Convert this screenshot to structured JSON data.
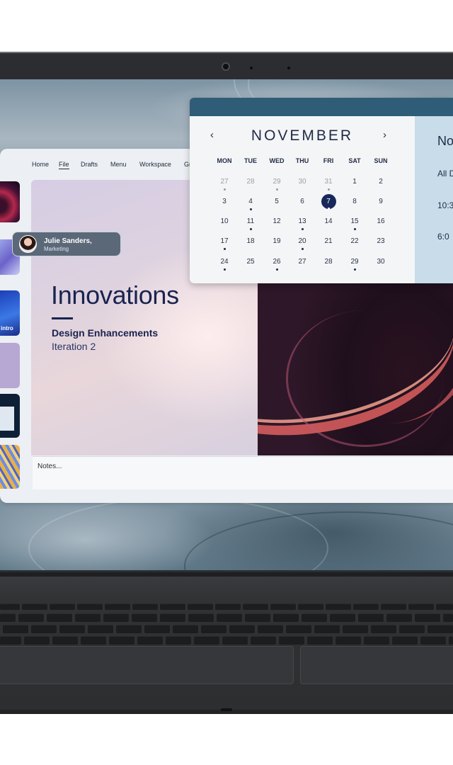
{
  "app": {
    "nav": [
      {
        "label": "Home",
        "active": false
      },
      {
        "label": "File",
        "active": true
      },
      {
        "label": "Drafts",
        "active": false
      },
      {
        "label": "Menu",
        "active": false
      },
      {
        "label": "Workspace",
        "active": false
      },
      {
        "label": "Gr",
        "active": false
      }
    ],
    "slide": {
      "title": "Innovations",
      "subtitle": "Design Enhancements",
      "iteration": "Iteration 2"
    },
    "thumbnails": [
      {
        "label": ""
      },
      {
        "label": ""
      },
      {
        "label": "intro"
      },
      {
        "label": ""
      },
      {
        "label": ""
      },
      {
        "label": ""
      }
    ],
    "notes_placeholder": "Notes..."
  },
  "user_chip": {
    "name": "Julie Sanders,",
    "role": "Marketing"
  },
  "calendar": {
    "month": "NOVEMBER",
    "prev_icon": "‹",
    "next_icon": "›",
    "weekdays": [
      "MON",
      "TUE",
      "WED",
      "THU",
      "FRI",
      "SAT",
      "SUN"
    ],
    "weeks": [
      [
        {
          "d": "27",
          "muted": true,
          "dot": true
        },
        {
          "d": "28",
          "muted": true,
          "dot": false
        },
        {
          "d": "29",
          "muted": true,
          "dot": true
        },
        {
          "d": "30",
          "muted": true,
          "dot": false
        },
        {
          "d": "31",
          "muted": true,
          "dot": true
        },
        {
          "d": "1",
          "muted": false,
          "dot": false
        },
        {
          "d": "2",
          "muted": false,
          "dot": false
        }
      ],
      [
        {
          "d": "3",
          "muted": false,
          "dot": false
        },
        {
          "d": "4",
          "muted": false,
          "dot": true
        },
        {
          "d": "5",
          "muted": false,
          "dot": false
        },
        {
          "d": "6",
          "muted": false,
          "dot": false
        },
        {
          "d": "7",
          "muted": false,
          "dot": true,
          "selected": true
        },
        {
          "d": "8",
          "muted": false,
          "dot": false
        },
        {
          "d": "9",
          "muted": false,
          "dot": false
        }
      ],
      [
        {
          "d": "10",
          "muted": false,
          "dot": false
        },
        {
          "d": "11",
          "muted": false,
          "dot": true
        },
        {
          "d": "12",
          "muted": false,
          "dot": false
        },
        {
          "d": "13",
          "muted": false,
          "dot": true
        },
        {
          "d": "14",
          "muted": false,
          "dot": false
        },
        {
          "d": "15",
          "muted": false,
          "dot": true
        },
        {
          "d": "16",
          "muted": false,
          "dot": false
        }
      ],
      [
        {
          "d": "17",
          "muted": false,
          "dot": true
        },
        {
          "d": "18",
          "muted": false,
          "dot": false
        },
        {
          "d": "19",
          "muted": false,
          "dot": false
        },
        {
          "d": "20",
          "muted": false,
          "dot": true
        },
        {
          "d": "21",
          "muted": false,
          "dot": false
        },
        {
          "d": "22",
          "muted": false,
          "dot": false
        },
        {
          "d": "23",
          "muted": false,
          "dot": false
        }
      ],
      [
        {
          "d": "24",
          "muted": false,
          "dot": true
        },
        {
          "d": "25",
          "muted": false,
          "dot": false
        },
        {
          "d": "26",
          "muted": false,
          "dot": true
        },
        {
          "d": "27",
          "muted": false,
          "dot": false
        },
        {
          "d": "28",
          "muted": false,
          "dot": false
        },
        {
          "d": "29",
          "muted": false,
          "dot": true
        },
        {
          "d": "30",
          "muted": false,
          "dot": false
        }
      ]
    ],
    "side_panel": {
      "heading": "No",
      "line1": "All D",
      "line2": "10:3",
      "line3": "6:0"
    }
  },
  "colors": {
    "calendar_header": "#2f5d78",
    "selected_day": "#17285a",
    "chip_background": "#5a6878",
    "slide_text": "#1a2350"
  },
  "icons": {
    "prev": "chevron-left-icon",
    "next": "chevron-right-icon",
    "webcam": "webcam-icon"
  }
}
